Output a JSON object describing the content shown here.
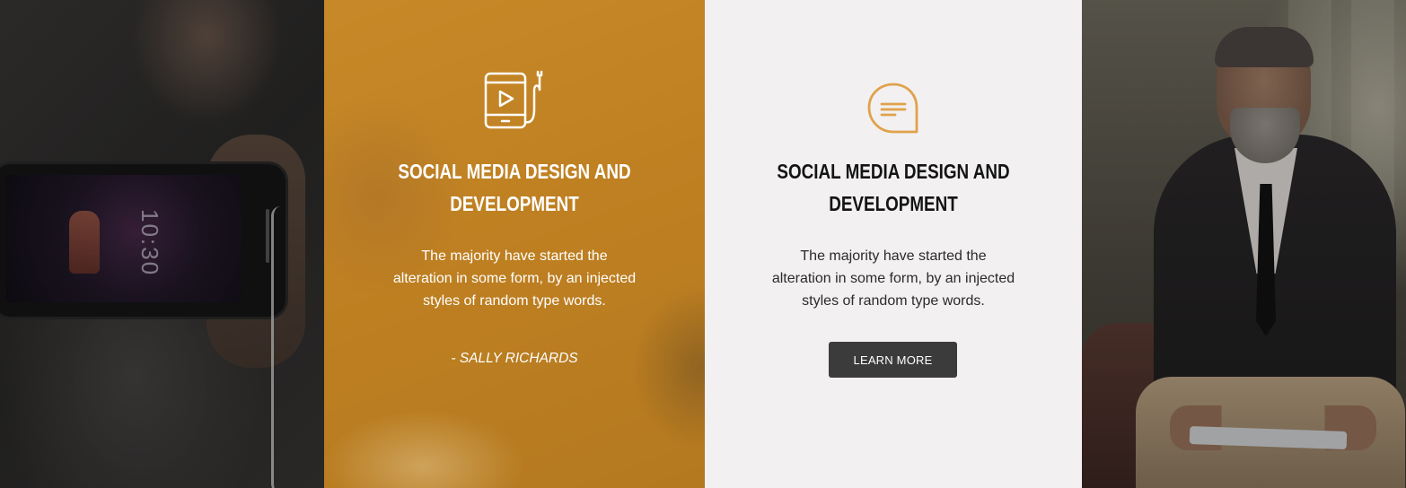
{
  "panels": {
    "photo_left": {
      "image": "man-holding-smartphone-photo",
      "phone_time": "10:30"
    },
    "featured_card": {
      "icon": "mobile-video-icon",
      "title_line1": "SOCIAL MEDIA DESIGN AND",
      "title_line2": "DEVELOPMENT",
      "description_lines": [
        "The majority have started the",
        "alteration in some form, by an injected",
        "styles of random type words."
      ],
      "author": "- SALLY RICHARDS",
      "overlay_color": "#c4851f"
    },
    "service_card": {
      "icon": "speech-bubble-icon",
      "icon_color": "#e0a24b",
      "title_line1": "SOCIAL MEDIA DESIGN AND",
      "title_line2": "DEVELOPMENT",
      "description_lines": [
        "The majority have started the",
        "alteration in some form, by an injected",
        "styles of random type words."
      ],
      "button_label": "LEARN MORE",
      "button_color": "#3b3b3b",
      "background": "#f2f0f1"
    },
    "photo_right": {
      "image": "bearded-businessman-with-tablet-photo"
    }
  }
}
